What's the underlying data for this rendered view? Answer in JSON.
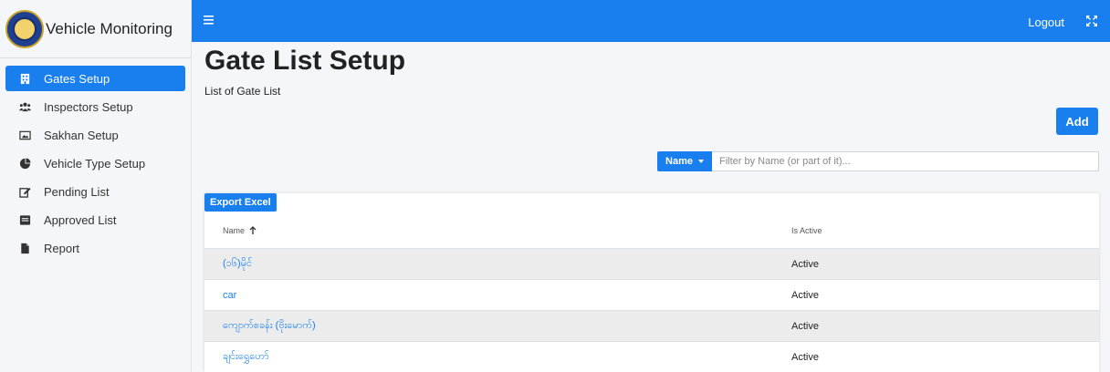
{
  "brand": {
    "title": "Vehicle Monitoring"
  },
  "sidebar": {
    "items": [
      {
        "label": "Gates Setup",
        "icon": "building-icon",
        "active": true
      },
      {
        "label": "Inspectors Setup",
        "icon": "users-icon",
        "active": false
      },
      {
        "label": "Sakhan Setup",
        "icon": "image-icon",
        "active": false
      },
      {
        "label": "Vehicle Type Setup",
        "icon": "pie-chart-icon",
        "active": false
      },
      {
        "label": "Pending List",
        "icon": "edit-icon",
        "active": false
      },
      {
        "label": "Approved List",
        "icon": "list-icon",
        "active": false
      },
      {
        "label": "Report",
        "icon": "file-icon",
        "active": false
      }
    ]
  },
  "navbar": {
    "logout_label": "Logout"
  },
  "page": {
    "title": "Gate List Setup",
    "subtitle": "List of Gate List",
    "add_label": "Add"
  },
  "filter": {
    "field_label": "Name",
    "placeholder": "Filter by Name (or part of it)..."
  },
  "table": {
    "export_label": "Export Excel",
    "columns": {
      "name": "Name",
      "is_active": "Is Active"
    },
    "rows": [
      {
        "name": "(၁၆)မိုင်",
        "is_active": "Active"
      },
      {
        "name": "car",
        "is_active": "Active"
      },
      {
        "name": "ကျောက်စခန်း (ဗိုးမောက်)",
        "is_active": "Active"
      },
      {
        "name": "ချင်းရွှေဟော်",
        "is_active": "Active"
      }
    ]
  },
  "colors": {
    "primary": "#1a7fee",
    "background": "#f4f6f9",
    "row_stripe": "#ececec"
  }
}
